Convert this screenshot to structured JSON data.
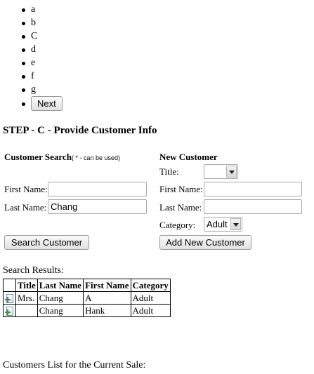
{
  "steps": {
    "items": [
      "a",
      "b",
      "C",
      "d",
      "e",
      "f",
      "g"
    ],
    "next_label": "Next"
  },
  "step_title": "STEP - C - Provide Customer Info",
  "customer_search": {
    "heading": "Customer Search",
    "hint": "( * - can be used)",
    "first_name_label": "First Name:",
    "first_name_value": "",
    "last_name_label": "Last Name:",
    "last_name_value": "Chang",
    "search_button": "Search Customer"
  },
  "new_customer": {
    "heading": "New Customer",
    "title_label": "Title:",
    "title_value": "",
    "first_name_label": "First Name:",
    "first_name_value": "",
    "last_name_label": "Last Name:",
    "last_name_value": "",
    "category_label": "Category:",
    "category_value": "Adult",
    "add_button": "Add New Customer"
  },
  "search_results": {
    "label": "Search Results:",
    "columns": [
      "Title",
      "Last Name",
      "First Name",
      "Category"
    ],
    "rows": [
      {
        "title": "Mrs.",
        "last_name": "Chang",
        "first_name": "A",
        "category": "Adult",
        "icon": "add-document-icon"
      },
      {
        "title": "",
        "last_name": "Chang",
        "first_name": "Hank",
        "category": "Adult",
        "icon": "add-document-icon"
      }
    ]
  },
  "customers_list_label": "Customers List for the Current Sale:"
}
